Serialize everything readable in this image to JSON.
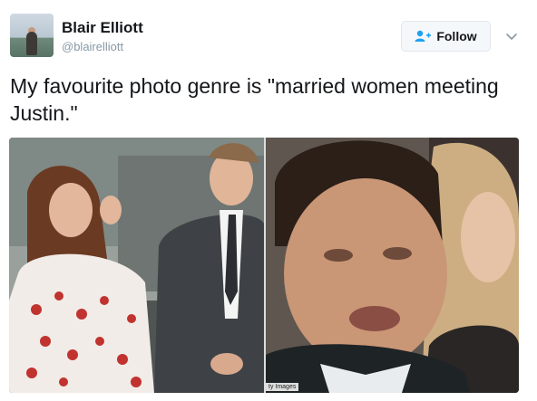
{
  "user": {
    "name": "Blair Elliott",
    "handle": "@blairelliott"
  },
  "actions": {
    "follow_label": "Follow",
    "follow_icon": "add-user-icon",
    "menu_icon": "chevron-down-icon"
  },
  "tweet": {
    "text": "My favourite photo genre is \"married women meeting Justin.\""
  },
  "media": {
    "photos": [
      {
        "alt_name": "photo-left"
      },
      {
        "alt_name": "photo-right",
        "credit": "ty Images"
      }
    ]
  },
  "colors": {
    "accent": "#1da1f2",
    "text": "#14171a",
    "secondary_text": "#8899a6",
    "button_bg": "#f5f8fa",
    "button_border": "#e1e8ed"
  }
}
